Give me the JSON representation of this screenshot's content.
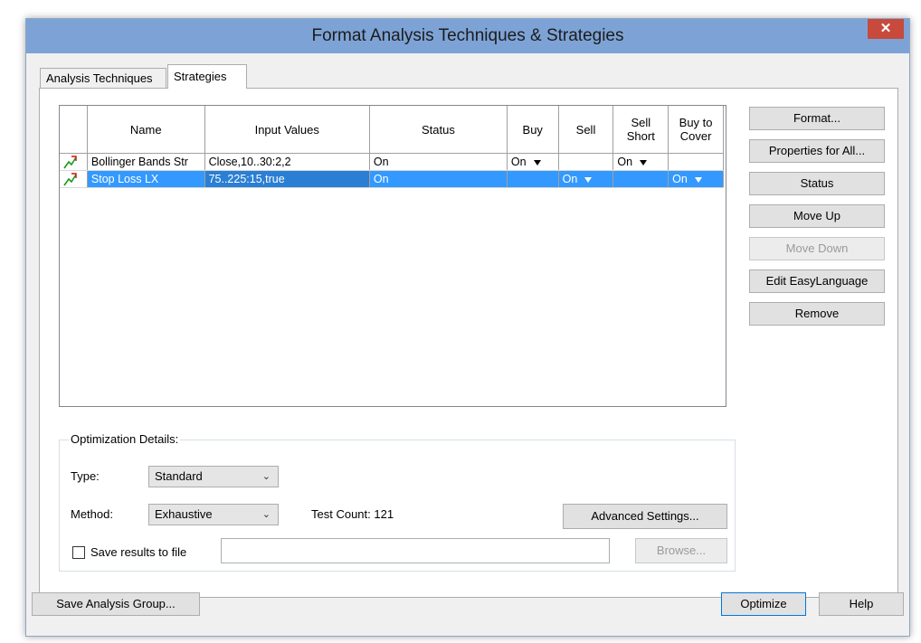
{
  "window": {
    "title": "Format Analysis Techniques & Strategies",
    "close_glyph": "✕"
  },
  "tabs": [
    {
      "label": "Analysis Techniques",
      "active": false
    },
    {
      "label": "Strategies",
      "active": true
    }
  ],
  "grid": {
    "columns": [
      "",
      "Name",
      "Input Values",
      "Status",
      "Buy",
      "Sell",
      "Sell Short",
      "Buy to Cover"
    ],
    "rows": [
      {
        "icon": "strategy-icon",
        "name": "Bollinger Bands Str",
        "inputs": "Close,10..30:2,2",
        "status": "On",
        "buy": "On",
        "sell": "",
        "sell_short": "On",
        "buy_to_cover": "",
        "selected": false
      },
      {
        "icon": "strategy-icon",
        "name": "Stop Loss LX",
        "inputs": "75..225:15,true",
        "status": "On",
        "buy": "",
        "sell": "On",
        "sell_short": "",
        "buy_to_cover": "On",
        "selected": true
      }
    ]
  },
  "side_buttons": {
    "format": "Format...",
    "properties_all": "Properties for All...",
    "status": "Status",
    "move_up": "Move Up",
    "move_down": "Move Down",
    "edit_easylanguage": "Edit EasyLanguage",
    "remove": "Remove"
  },
  "optimization": {
    "legend": "Optimization Details:",
    "type_label": "Type:",
    "type_value": "Standard",
    "method_label": "Method:",
    "method_value": "Exhaustive",
    "test_count": "Test Count: 121",
    "advanced_settings": "Advanced Settings...",
    "save_results_label": "Save results to file",
    "save_results_checked": false,
    "file_path": "",
    "browse": "Browse..."
  },
  "footer": {
    "save_group": "Save Analysis Group...",
    "optimize": "Optimize",
    "help": "Help"
  },
  "colors": {
    "selection": "#3399ff",
    "titlebar": "#7da3d6",
    "close": "#c74a3d"
  }
}
